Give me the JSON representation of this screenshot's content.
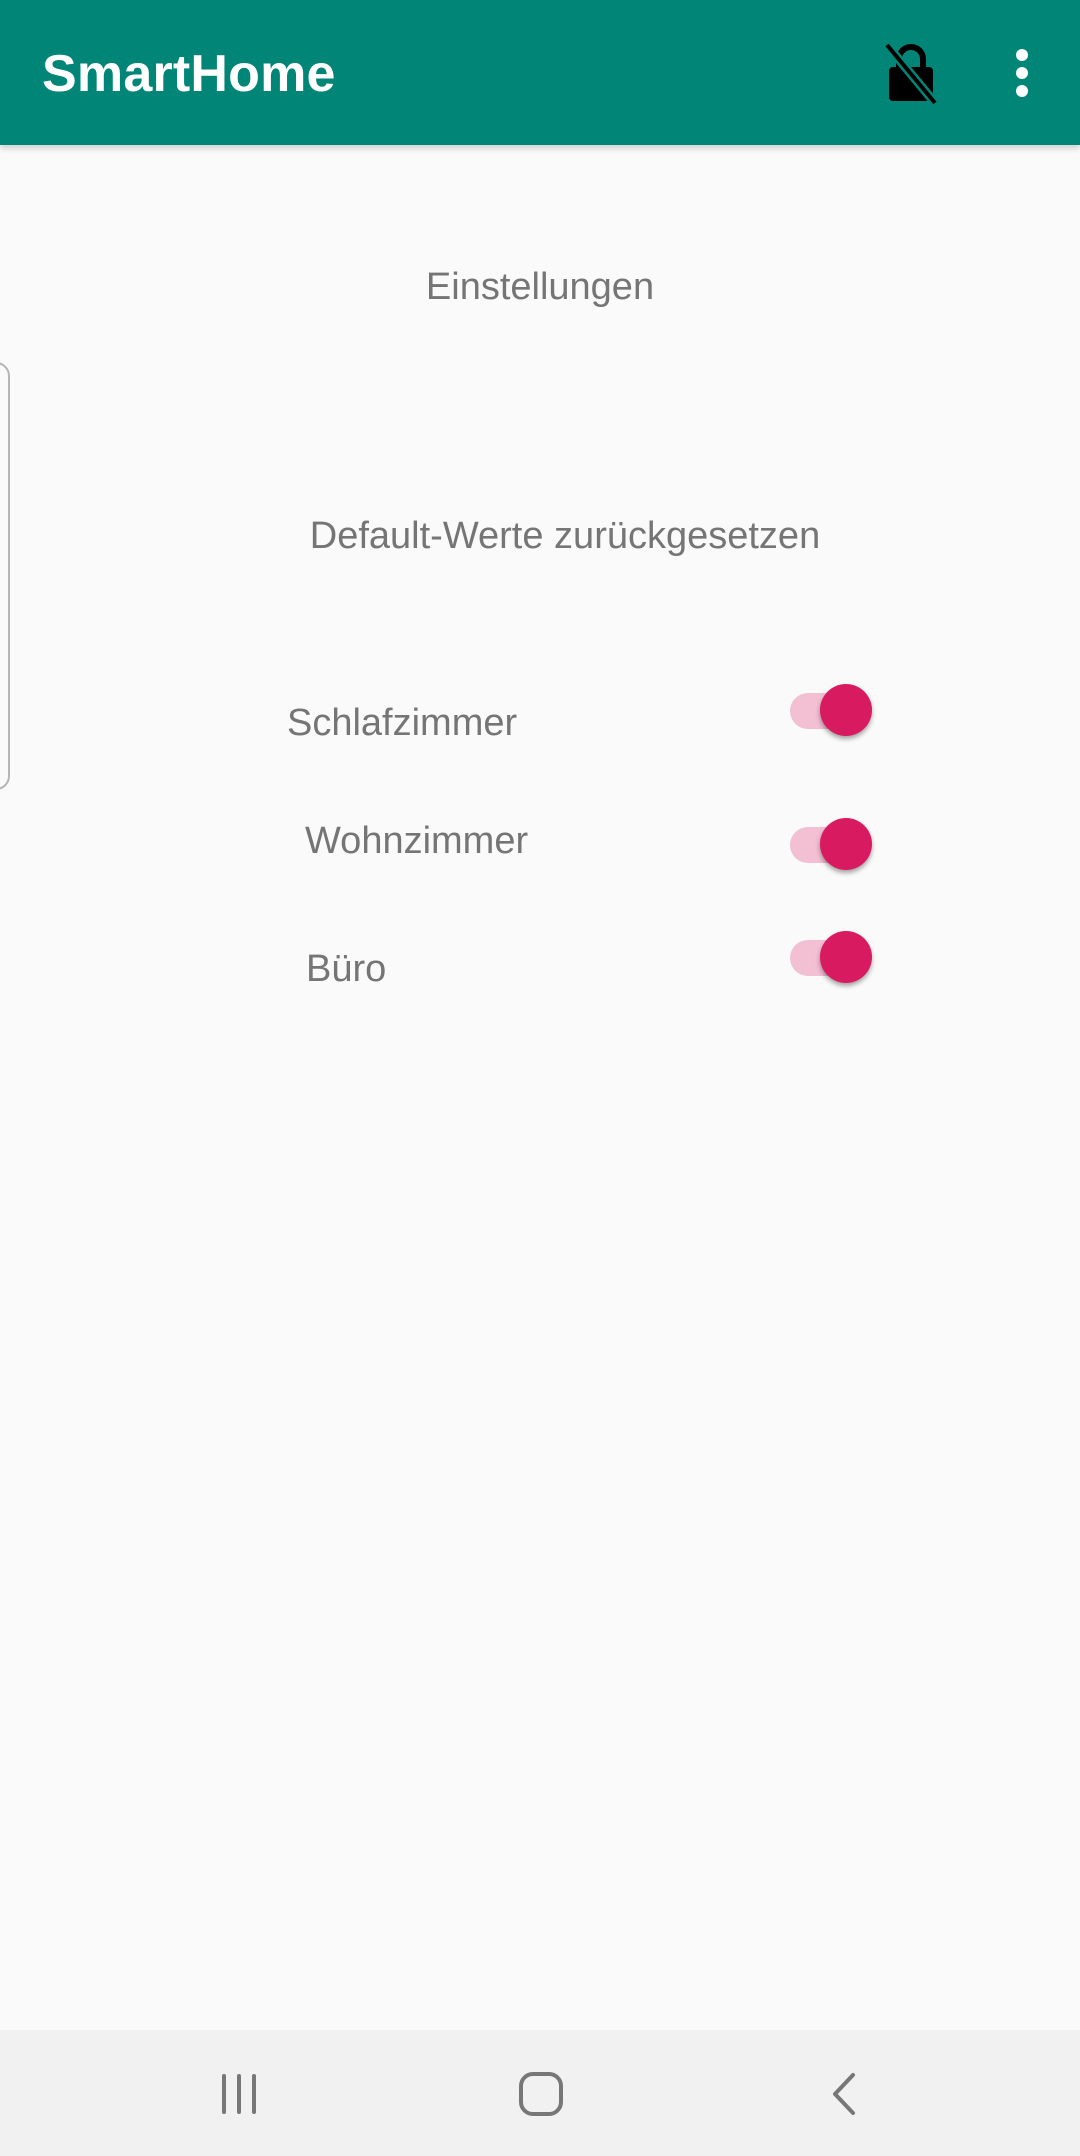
{
  "appbar": {
    "title": "SmartHome",
    "background": "#008577",
    "icons": [
      "lock-off-icon",
      "more-vert-icon"
    ]
  },
  "settings": {
    "title": "Einstellungen",
    "reset_label": "Default-Werte zurückgesetzen",
    "rooms": [
      {
        "label": "Schlafzimmer",
        "enabled": true
      },
      {
        "label": "Wohnzimmer",
        "enabled": true
      },
      {
        "label": "Büro",
        "enabled": true
      }
    ],
    "accent": "#d81b60"
  },
  "navbar": {
    "icons": [
      "recent-apps-icon",
      "home-icon",
      "back-icon"
    ]
  }
}
